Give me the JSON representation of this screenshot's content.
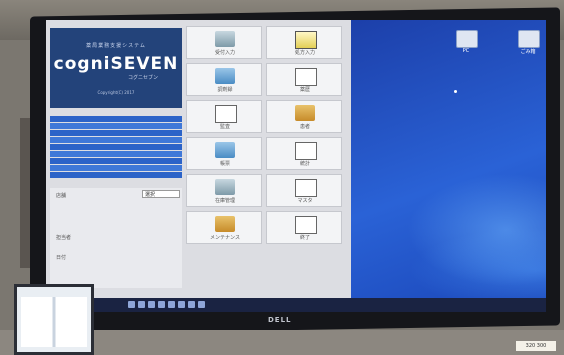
{
  "app": {
    "logo": {
      "subtitle": "薬局業務支援システム",
      "name": "cogniSEVEN",
      "kana": "コグニセブン",
      "copyright": "Copyright(C) 2017"
    },
    "menu_tiles": [
      {
        "label": "受付入力",
        "icon": "calculator-icon"
      },
      {
        "label": "処方入力",
        "icon": "prescription-doc-icon"
      },
      {
        "label": "調剤録",
        "icon": "computer-arrow-icon"
      },
      {
        "label": "薬歴",
        "icon": "document-arrow-icon"
      },
      {
        "label": "監査",
        "icon": "fingerprint-icon"
      },
      {
        "label": "患者",
        "icon": "folder-computer-icon"
      },
      {
        "label": "帳票",
        "icon": "computer-icon"
      },
      {
        "label": "統計",
        "icon": "tray-arrow-icon"
      },
      {
        "label": "在庫管理",
        "icon": "printer-icon"
      },
      {
        "label": "マスタ",
        "icon": "book-arrow-icon"
      },
      {
        "label": "メンテナンス",
        "icon": "tools-folder-icon"
      },
      {
        "label": "終了",
        "icon": "exit-doc-icon"
      }
    ],
    "info": {
      "dropdown_value": "選択",
      "rows": [
        "店舗",
        "担当者",
        "日付"
      ]
    }
  },
  "desktop": {
    "icons": [
      "PC",
      "ごみ箱"
    ]
  },
  "monitor": {
    "brand": "DELL"
  },
  "sticker": {
    "text": "320 300"
  }
}
